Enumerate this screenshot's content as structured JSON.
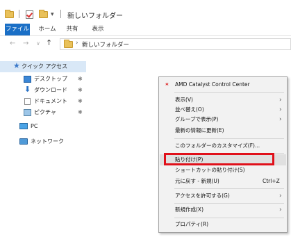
{
  "window": {
    "title": "新しいフォルダー"
  },
  "ribbon": {
    "tabs": [
      "ファイル",
      "ホーム",
      "共有",
      "表示"
    ]
  },
  "address": {
    "path": "新しいフォルダー"
  },
  "nav_pane": {
    "quick_access": "クイック アクセス",
    "items": [
      {
        "label": "デスクトップ",
        "pinned": true
      },
      {
        "label": "ダウンロード",
        "pinned": true
      },
      {
        "label": "ドキュメント",
        "pinned": true
      },
      {
        "label": "ピクチャ",
        "pinned": true
      }
    ],
    "pc": "PC",
    "network": "ネットワーク"
  },
  "context_menu": {
    "amd": "AMD Catalyst Control Center",
    "view": "表示(V)",
    "sort": "並べ替え(O)",
    "group": "グループで表示(P)",
    "refresh": "最新の情報に更新(E)",
    "customize": "このフォルダーのカスタマイズ(F)...",
    "paste": "貼り付け(P)",
    "paste_shortcut": "ショートカットの貼り付け(S)",
    "undo": "元に戻す - 新規(U)",
    "undo_shortcut": "Ctrl+Z",
    "access": "アクセスを許可する(G)",
    "new": "新規作成(X)",
    "properties": "プロパティ(R)"
  },
  "colors": {
    "file_tab": "#1a6fc6",
    "highlight_box": "#e0101a"
  }
}
